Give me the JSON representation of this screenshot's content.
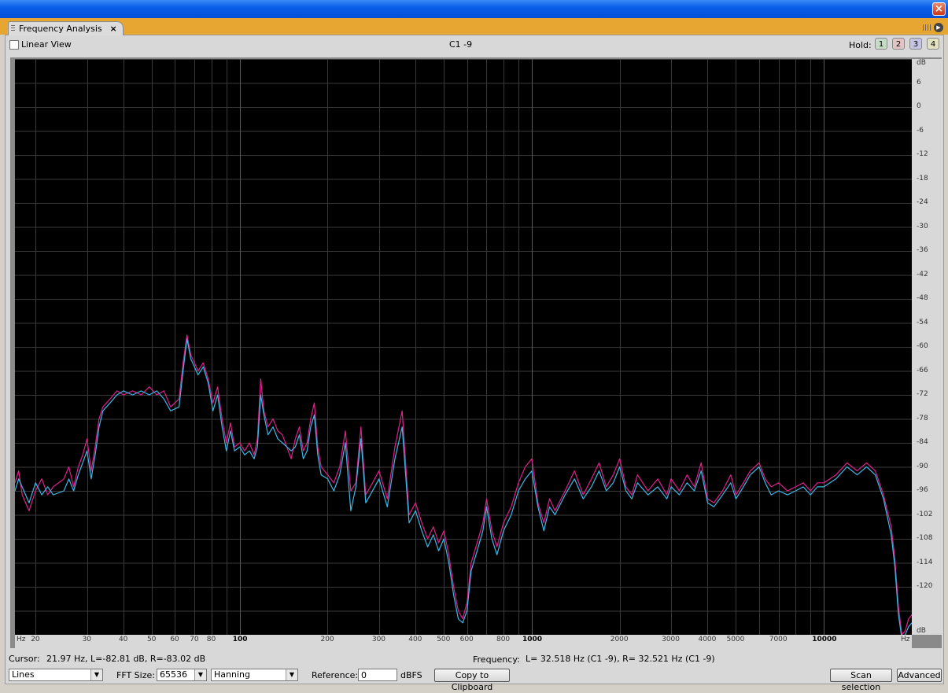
{
  "window": {
    "close_glyph": "×"
  },
  "tab": {
    "title": "Frequency Analysis",
    "close_glyph": "×"
  },
  "toolbar": {
    "linear_view_label": "Linear View",
    "linear_view_checked": false,
    "center_title": "C1 -9",
    "hold_label": "Hold:",
    "hold_buttons": [
      "1",
      "2",
      "3",
      "4"
    ],
    "hold_colors": [
      "#c6dcc6",
      "#e2c4c4",
      "#c4c4e2",
      "#e2e2c0"
    ]
  },
  "x_axis_labels": [
    "Hz",
    "20",
    "30",
    "40",
    "50",
    "60",
    "70",
    "80",
    "100",
    "200",
    "300",
    "400",
    "500",
    "600",
    "800",
    "1000",
    "2000",
    "3000",
    "4000",
    "5000",
    "7000",
    "10000",
    "Hz"
  ],
  "y_axis_labels": [
    "dB",
    "6",
    "0",
    "-6",
    "-12",
    "-18",
    "-24",
    "-30",
    "-36",
    "-42",
    "-48",
    "-54",
    "-60",
    "-66",
    "-72",
    "-78",
    "-84",
    "-90",
    "-96",
    "-102",
    "-108",
    "-114",
    "-120",
    "dB"
  ],
  "status": {
    "cursor_label": "Cursor:",
    "cursor_value": "21.97 Hz, L=-82.81 dB, R=-83.02 dB",
    "frequency_label": "Frequency:",
    "frequency_value": "L= 32.518 Hz (C1 -9), R= 32.521 Hz (C1 -9)"
  },
  "controls": {
    "plot_type": "Lines",
    "fft_label": "FFT Size:",
    "fft_size": "65536",
    "window_fn": "Hanning",
    "reference_label": "Reference:",
    "reference_value": "0",
    "reference_unit": "dBFS",
    "copy_button": "Copy to Clipboard",
    "scan_button": "Scan selection",
    "advanced_button": "Advanced"
  },
  "chart_data": {
    "type": "line",
    "x_scale": "log",
    "xlim": [
      17,
      20000
    ],
    "ylim": [
      -132,
      12
    ],
    "grid": true,
    "series": [
      {
        "color": "#e0208c",
        "points": [
          [
            17,
            -94
          ],
          [
            17.5,
            -91
          ],
          [
            18,
            -97
          ],
          [
            19,
            -101
          ],
          [
            20,
            -96
          ],
          [
            21,
            -93
          ],
          [
            22,
            -97
          ],
          [
            23,
            -95
          ],
          [
            25,
            -93
          ],
          [
            26,
            -90
          ],
          [
            27,
            -95
          ],
          [
            28,
            -90
          ],
          [
            29,
            -87
          ],
          [
            30,
            -83
          ],
          [
            31,
            -91
          ],
          [
            32,
            -85
          ],
          [
            33,
            -78
          ],
          [
            34,
            -75
          ],
          [
            36,
            -73
          ],
          [
            38,
            -71
          ],
          [
            40,
            -72
          ],
          [
            43,
            -71
          ],
          [
            46,
            -72
          ],
          [
            49,
            -70
          ],
          [
            52,
            -72
          ],
          [
            55,
            -71
          ],
          [
            58,
            -75
          ],
          [
            62,
            -73
          ],
          [
            64,
            -64
          ],
          [
            66,
            -57
          ],
          [
            68,
            -62
          ],
          [
            70,
            -64
          ],
          [
            72,
            -66
          ],
          [
            75,
            -64
          ],
          [
            78,
            -68
          ],
          [
            81,
            -74
          ],
          [
            84,
            -70
          ],
          [
            87,
            -78
          ],
          [
            90,
            -84
          ],
          [
            93,
            -79
          ],
          [
            96,
            -85
          ],
          [
            100,
            -84
          ],
          [
            104,
            -86
          ],
          [
            108,
            -84
          ],
          [
            112,
            -87
          ],
          [
            115,
            -83
          ],
          [
            118,
            -68
          ],
          [
            121,
            -76
          ],
          [
            125,
            -80
          ],
          [
            130,
            -78
          ],
          [
            135,
            -81
          ],
          [
            140,
            -82
          ],
          [
            150,
            -88
          ],
          [
            155,
            -83
          ],
          [
            160,
            -80
          ],
          [
            165,
            -86
          ],
          [
            170,
            -84
          ],
          [
            175,
            -78
          ],
          [
            180,
            -74
          ],
          [
            185,
            -85
          ],
          [
            190,
            -90
          ],
          [
            200,
            -92
          ],
          [
            210,
            -94
          ],
          [
            220,
            -90
          ],
          [
            230,
            -81
          ],
          [
            240,
            -96
          ],
          [
            250,
            -94
          ],
          [
            260,
            -80
          ],
          [
            270,
            -97
          ],
          [
            280,
            -95
          ],
          [
            300,
            -91
          ],
          [
            320,
            -98
          ],
          [
            340,
            -85
          ],
          [
            360,
            -76
          ],
          [
            380,
            -102
          ],
          [
            400,
            -99
          ],
          [
            420,
            -104
          ],
          [
            440,
            -108
          ],
          [
            460,
            -105
          ],
          [
            480,
            -109
          ],
          [
            500,
            -106
          ],
          [
            520,
            -112
          ],
          [
            540,
            -120
          ],
          [
            560,
            -126
          ],
          [
            580,
            -128
          ],
          [
            600,
            -124
          ],
          [
            620,
            -114
          ],
          [
            650,
            -109
          ],
          [
            680,
            -104
          ],
          [
            700,
            -98
          ],
          [
            730,
            -106
          ],
          [
            760,
            -110
          ],
          [
            800,
            -104
          ],
          [
            850,
            -100
          ],
          [
            900,
            -94
          ],
          [
            950,
            -90
          ],
          [
            1000,
            -88
          ],
          [
            1050,
            -99
          ],
          [
            1100,
            -104
          ],
          [
            1150,
            -98
          ],
          [
            1200,
            -101
          ],
          [
            1300,
            -96
          ],
          [
            1400,
            -91
          ],
          [
            1500,
            -97
          ],
          [
            1600,
            -93
          ],
          [
            1700,
            -89
          ],
          [
            1800,
            -95
          ],
          [
            1900,
            -92
          ],
          [
            2000,
            -88
          ],
          [
            2100,
            -95
          ],
          [
            2200,
            -97
          ],
          [
            2300,
            -92
          ],
          [
            2500,
            -96
          ],
          [
            2700,
            -93
          ],
          [
            2900,
            -97
          ],
          [
            3000,
            -93
          ],
          [
            3200,
            -96
          ],
          [
            3400,
            -92
          ],
          [
            3600,
            -95
          ],
          [
            3800,
            -89
          ],
          [
            4000,
            -98
          ],
          [
            4200,
            -99
          ],
          [
            4500,
            -96
          ],
          [
            4800,
            -92
          ],
          [
            5000,
            -97
          ],
          [
            5300,
            -94
          ],
          [
            5600,
            -91
          ],
          [
            6000,
            -89
          ],
          [
            6300,
            -93
          ],
          [
            6600,
            -95
          ],
          [
            7000,
            -94
          ],
          [
            7500,
            -96
          ],
          [
            8000,
            -95
          ],
          [
            8500,
            -94
          ],
          [
            9000,
            -96
          ],
          [
            9500,
            -94
          ],
          [
            10000,
            -94
          ],
          [
            11000,
            -92
          ],
          [
            12000,
            -89
          ],
          [
            13000,
            -91
          ],
          [
            14000,
            -89
          ],
          [
            15000,
            -91
          ],
          [
            16000,
            -97
          ],
          [
            17000,
            -105
          ],
          [
            17500,
            -113
          ],
          [
            18000,
            -125
          ],
          [
            18500,
            -132
          ],
          [
            19000,
            -131
          ],
          [
            19500,
            -128
          ],
          [
            20000,
            -127
          ]
        ]
      },
      {
        "color": "#3cb8e8",
        "points": [
          [
            17,
            -96
          ],
          [
            17.5,
            -93
          ],
          [
            18,
            -95
          ],
          [
            19,
            -99
          ],
          [
            20,
            -94
          ],
          [
            21,
            -97
          ],
          [
            22,
            -95
          ],
          [
            23,
            -97
          ],
          [
            25,
            -96
          ],
          [
            26,
            -93
          ],
          [
            27,
            -96
          ],
          [
            28,
            -92
          ],
          [
            29,
            -89
          ],
          [
            30,
            -86
          ],
          [
            31,
            -93
          ],
          [
            32,
            -87
          ],
          [
            33,
            -80
          ],
          [
            34,
            -76
          ],
          [
            36,
            -74
          ],
          [
            38,
            -72
          ],
          [
            40,
            -71
          ],
          [
            43,
            -72
          ],
          [
            46,
            -71
          ],
          [
            49,
            -72
          ],
          [
            52,
            -71
          ],
          [
            55,
            -73
          ],
          [
            58,
            -76
          ],
          [
            62,
            -75
          ],
          [
            64,
            -66
          ],
          [
            66,
            -58
          ],
          [
            68,
            -63
          ],
          [
            70,
            -65
          ],
          [
            72,
            -67
          ],
          [
            75,
            -65
          ],
          [
            78,
            -69
          ],
          [
            81,
            -76
          ],
          [
            84,
            -72
          ],
          [
            87,
            -80
          ],
          [
            90,
            -86
          ],
          [
            93,
            -81
          ],
          [
            96,
            -86
          ],
          [
            100,
            -85
          ],
          [
            104,
            -87
          ],
          [
            108,
            -86
          ],
          [
            112,
            -88
          ],
          [
            115,
            -85
          ],
          [
            118,
            -72
          ],
          [
            121,
            -77
          ],
          [
            125,
            -82
          ],
          [
            130,
            -80
          ],
          [
            135,
            -83
          ],
          [
            140,
            -84
          ],
          [
            150,
            -86
          ],
          [
            155,
            -85
          ],
          [
            160,
            -82
          ],
          [
            165,
            -88
          ],
          [
            170,
            -86
          ],
          [
            175,
            -80
          ],
          [
            180,
            -77
          ],
          [
            185,
            -87
          ],
          [
            190,
            -92
          ],
          [
            200,
            -93
          ],
          [
            210,
            -96
          ],
          [
            220,
            -92
          ],
          [
            230,
            -84
          ],
          [
            240,
            -101
          ],
          [
            250,
            -95
          ],
          [
            260,
            -83
          ],
          [
            270,
            -99
          ],
          [
            280,
            -97
          ],
          [
            300,
            -93
          ],
          [
            320,
            -100
          ],
          [
            340,
            -88
          ],
          [
            360,
            -80
          ],
          [
            380,
            -104
          ],
          [
            400,
            -101
          ],
          [
            420,
            -106
          ],
          [
            440,
            -110
          ],
          [
            460,
            -107
          ],
          [
            480,
            -111
          ],
          [
            500,
            -108
          ],
          [
            520,
            -114
          ],
          [
            540,
            -122
          ],
          [
            560,
            -128
          ],
          [
            580,
            -129
          ],
          [
            600,
            -126
          ],
          [
            620,
            -116
          ],
          [
            650,
            -111
          ],
          [
            680,
            -106
          ],
          [
            700,
            -100
          ],
          [
            730,
            -108
          ],
          [
            760,
            -112
          ],
          [
            800,
            -106
          ],
          [
            850,
            -102
          ],
          [
            900,
            -96
          ],
          [
            950,
            -93
          ],
          [
            1000,
            -91
          ],
          [
            1050,
            -100
          ],
          [
            1100,
            -106
          ],
          [
            1150,
            -100
          ],
          [
            1200,
            -102
          ],
          [
            1300,
            -97
          ],
          [
            1400,
            -93
          ],
          [
            1500,
            -98
          ],
          [
            1600,
            -95
          ],
          [
            1700,
            -91
          ],
          [
            1800,
            -96
          ],
          [
            1900,
            -94
          ],
          [
            2000,
            -90
          ],
          [
            2100,
            -96
          ],
          [
            2200,
            -98
          ],
          [
            2300,
            -94
          ],
          [
            2500,
            -97
          ],
          [
            2700,
            -95
          ],
          [
            2900,
            -98
          ],
          [
            3000,
            -95
          ],
          [
            3200,
            -97
          ],
          [
            3400,
            -94
          ],
          [
            3600,
            -96
          ],
          [
            3800,
            -91
          ],
          [
            4000,
            -99
          ],
          [
            4200,
            -100
          ],
          [
            4500,
            -97
          ],
          [
            4800,
            -94
          ],
          [
            5000,
            -98
          ],
          [
            5300,
            -95
          ],
          [
            5600,
            -92
          ],
          [
            6000,
            -90
          ],
          [
            6300,
            -94
          ],
          [
            6600,
            -97
          ],
          [
            7000,
            -96
          ],
          [
            7500,
            -97
          ],
          [
            8000,
            -96
          ],
          [
            8500,
            -95
          ],
          [
            9000,
            -97
          ],
          [
            9500,
            -95
          ],
          [
            10000,
            -95
          ],
          [
            11000,
            -93
          ],
          [
            12000,
            -90
          ],
          [
            13000,
            -92
          ],
          [
            14000,
            -90
          ],
          [
            15000,
            -92
          ],
          [
            16000,
            -98
          ],
          [
            17000,
            -107
          ],
          [
            17500,
            -115
          ],
          [
            18000,
            -127
          ],
          [
            18500,
            -133
          ],
          [
            19000,
            -132
          ],
          [
            19500,
            -130
          ],
          [
            20000,
            -129
          ]
        ]
      }
    ]
  }
}
